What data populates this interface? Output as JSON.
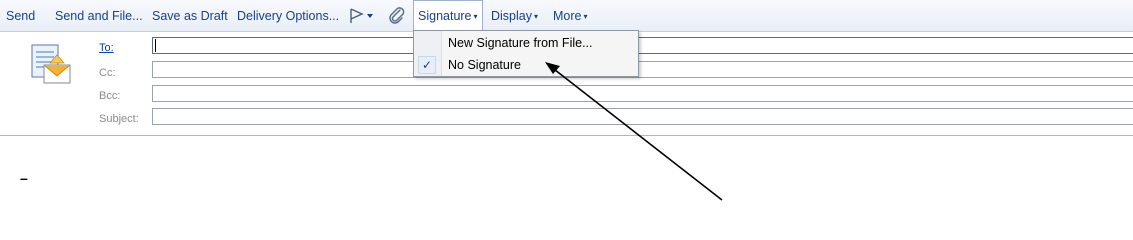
{
  "toolbar": {
    "send": "Send",
    "send_and_file": "Send and File...",
    "save_as_draft": "Save as Draft",
    "delivery_options": "Delivery Options...",
    "flag_icon": "flag-icon",
    "attach_icon": "paperclip-icon",
    "signature": "Signature",
    "display": "Display",
    "more": "More",
    "dropdown_arrow": "▾"
  },
  "fields": {
    "to_label": "To:",
    "cc_label": "Cc:",
    "bcc_label": "Bcc:",
    "subject_label": "Subject:",
    "to_value": "",
    "cc_value": "",
    "bcc_value": "",
    "subject_value": ""
  },
  "compose_icon": "compose-message-icon",
  "body": {
    "text": "–"
  },
  "signature_menu": {
    "items": [
      {
        "label": "New Signature from File...",
        "checked": false
      },
      {
        "label": "No Signature",
        "checked": true
      }
    ],
    "check_mark": "✓"
  },
  "colors": {
    "toolbar_text": "#15428b",
    "link": "#0645ad",
    "label_gray": "#8a8a8a"
  }
}
